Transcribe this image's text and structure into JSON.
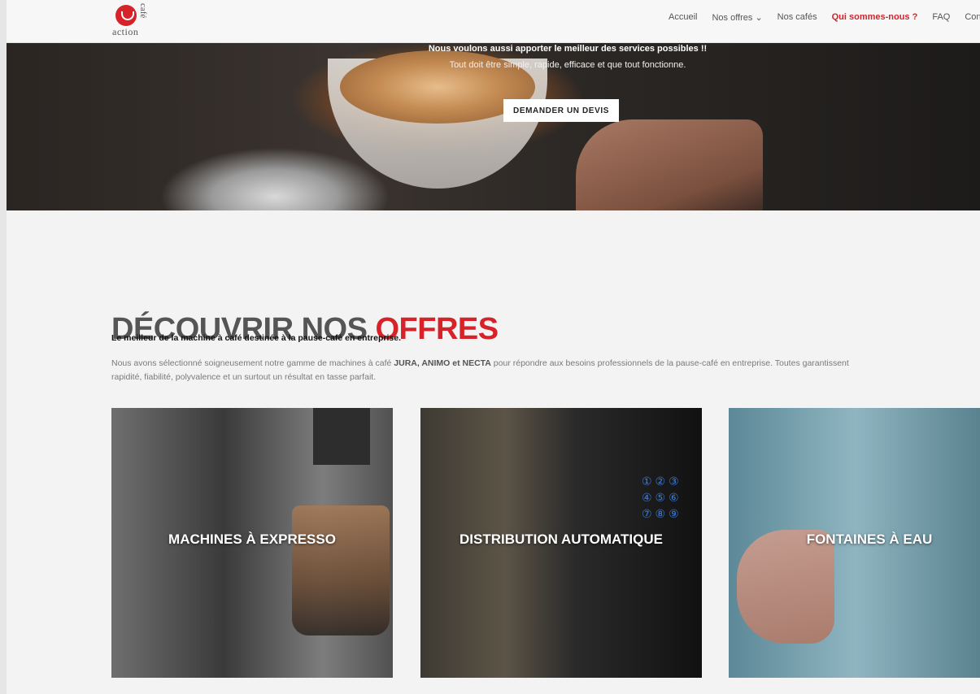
{
  "logo": {
    "brand_side": "café",
    "brand_word": "action"
  },
  "nav": {
    "items": [
      {
        "label": "Accueil"
      },
      {
        "label": "Nos offres ⌄"
      },
      {
        "label": "Nos cafés"
      },
      {
        "label": "Qui sommes-nous ?"
      },
      {
        "label": "FAQ"
      },
      {
        "label": "Cont"
      }
    ]
  },
  "hero": {
    "line1": "Nous voulons aussi apporter le meilleur des services possibles !!",
    "line2": "Tout doit être simple, rapide, efficace et que tout fonctionne.",
    "cta": "DEMANDER UN DEVIS"
  },
  "offers": {
    "title_plain": "DÉCOUVRIR NOS ",
    "title_accent": "OFFRES",
    "subheading": "Le meilleur de la machine à café destinée à la pause-café en entreprise.",
    "desc_before": "Nous avons sélectionné soigneusement notre gamme de machines à café ",
    "desc_brands": "JURA, ANIMO et NECTA",
    "desc_after": " pour répondre aux besoins professionnels de la pause-café en entreprise. Toutes garantissent rapidité, fiabilité, polyvalence et un surtout un résultat en tasse parfait.",
    "cards": [
      {
        "label": "MACHINES À EXPRESSO"
      },
      {
        "label": "DISTRIBUTION AUTOMATIQUE"
      },
      {
        "label": "FONTAINES À EAU"
      }
    ],
    "keypad": "①②③\n④⑤⑥\n⑦⑧⑨"
  },
  "colors": {
    "accent": "#d6232a",
    "nav_bg": "#f7f7f7",
    "page_bg": "#f3f3f3"
  }
}
